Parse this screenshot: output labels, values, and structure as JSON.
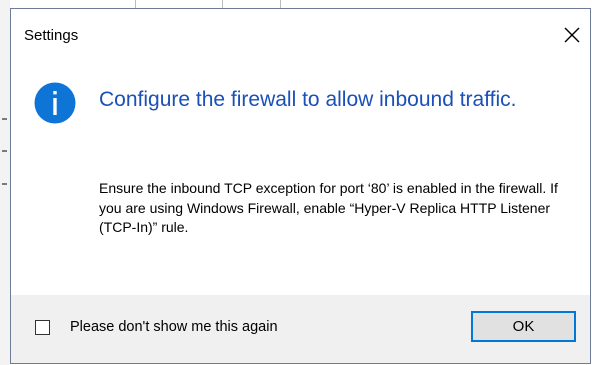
{
  "dialog": {
    "title": "Settings",
    "heading": "Configure the firewall to allow inbound traffic.",
    "message": "Ensure the inbound TCP exception for port ‘80’ is enabled in the firewall. If you are using Windows Firewall, enable “Hyper-V Replica HTTP Listener (TCP-In)” rule.",
    "icon": "info-icon",
    "close_icon": "close-icon"
  },
  "footer": {
    "checkbox_label": "Please don't show me this again",
    "checkbox_checked": false,
    "ok_label": "OK"
  },
  "colors": {
    "heading": "#1a50b8",
    "info_icon": "#0e74d6",
    "footer_background": "#f0f0f0",
    "button_focus_border": "#0078d7"
  }
}
